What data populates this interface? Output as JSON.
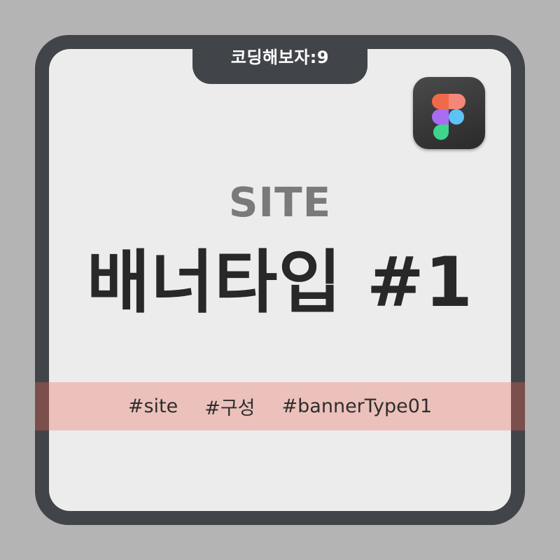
{
  "badge": {
    "label": "코딩해보자:9"
  },
  "app_icon": {
    "name": "figma-icon"
  },
  "headline": {
    "kicker": "SITE",
    "title": "배너타입 #1"
  },
  "tags": [
    "#site",
    "#구성",
    "#bannerType01"
  ],
  "colors": {
    "background": "#b4b4b4",
    "frame": "#414549",
    "card": "#ececec",
    "kicker": "#7a7a7a",
    "title": "#282828",
    "tag_band": "#ecc1bb",
    "tag_band_edge": "#7a4f4c",
    "figma_red": "#f24e1e",
    "figma_orange": "#ff7262",
    "figma_purple": "#a259ff",
    "figma_blue": "#1abcfe",
    "figma_green": "#0acf83"
  }
}
